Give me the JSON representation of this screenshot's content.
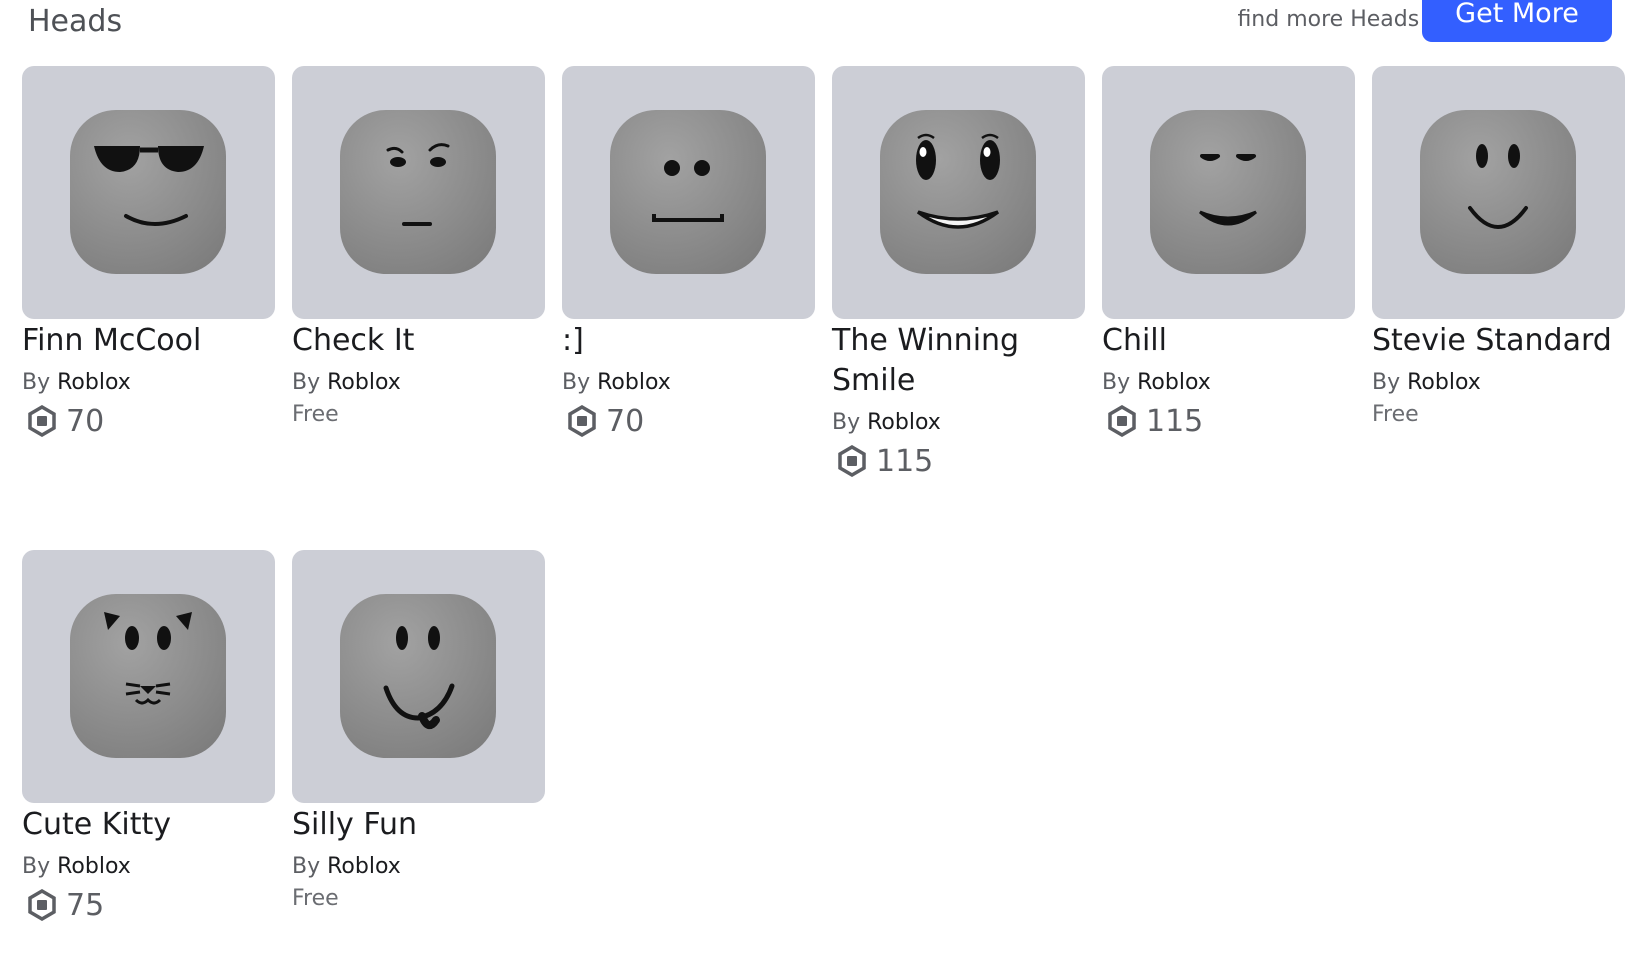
{
  "section": {
    "title": "Heads",
    "promo_text": "find more Heads!",
    "get_more_label": "Get More"
  },
  "items": [
    {
      "name": "Finn McCool",
      "by": "By",
      "creator": "Roblox",
      "price": "70",
      "face": "sunglasses-face"
    },
    {
      "name": "Check It",
      "by": "By",
      "creator": "Roblox",
      "price": "Free",
      "face": "check-it-face"
    },
    {
      "name": ":]",
      "by": "By",
      "creator": "Roblox",
      "price": "70",
      "face": "dots-flat-face"
    },
    {
      "name": "The Winning Smile",
      "by": "By",
      "creator": "Roblox",
      "price": "115",
      "face": "winning-smile-face"
    },
    {
      "name": "Chill",
      "by": "By",
      "creator": "Roblox",
      "price": "115",
      "face": "chill-face"
    },
    {
      "name": "Stevie Standard",
      "by": "By",
      "creator": "Roblox",
      "price": "Free",
      "face": "standard-smile-face"
    },
    {
      "name": "Cute Kitty",
      "by": "By",
      "creator": "Roblox",
      "price": "75",
      "face": "kitty-face"
    },
    {
      "name": "Silly Fun",
      "by": "By",
      "creator": "Roblox",
      "price": "Free",
      "face": "tongue-smile-face"
    }
  ],
  "icons": {
    "currency": "robux-icon"
  },
  "colors": {
    "accent": "#335fff",
    "thumb_bg": "#ccced6",
    "head": "#8f8f8f"
  }
}
